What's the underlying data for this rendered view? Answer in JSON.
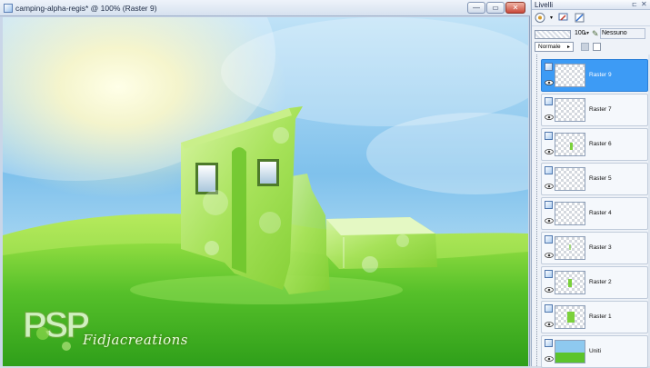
{
  "image_window": {
    "title": "camping-alpha-regis* @ 100% (Raster 9)",
    "controls": {
      "minimize": "—",
      "maximize": "▭",
      "close": "✕"
    }
  },
  "canvas": {
    "watermark": {
      "logo": "PSP",
      "text": "Fidjacreations"
    }
  },
  "layers_panel": {
    "title": "Livelli",
    "toolbar_icons": [
      "new-layer-icon",
      "delete-layer-icon",
      "properties-icon"
    ],
    "opacity": "100",
    "mask_label": "Nessuno",
    "blend_mode": "Normale",
    "layers": [
      {
        "name": "Raster 9",
        "selected": true
      },
      {
        "name": "Raster 7",
        "selected": false
      },
      {
        "name": "Raster 6",
        "selected": false
      },
      {
        "name": "Raster 5",
        "selected": false
      },
      {
        "name": "Raster 4",
        "selected": false
      },
      {
        "name": "Raster 3",
        "selected": false
      },
      {
        "name": "Raster 2",
        "selected": false
      },
      {
        "name": "Raster 1",
        "selected": false
      },
      {
        "name": "Uniti",
        "selected": false
      }
    ]
  },
  "colors": {
    "selection": "#3d9bf5",
    "grass": "#4cc22a",
    "sky": "#8ec9ef"
  }
}
